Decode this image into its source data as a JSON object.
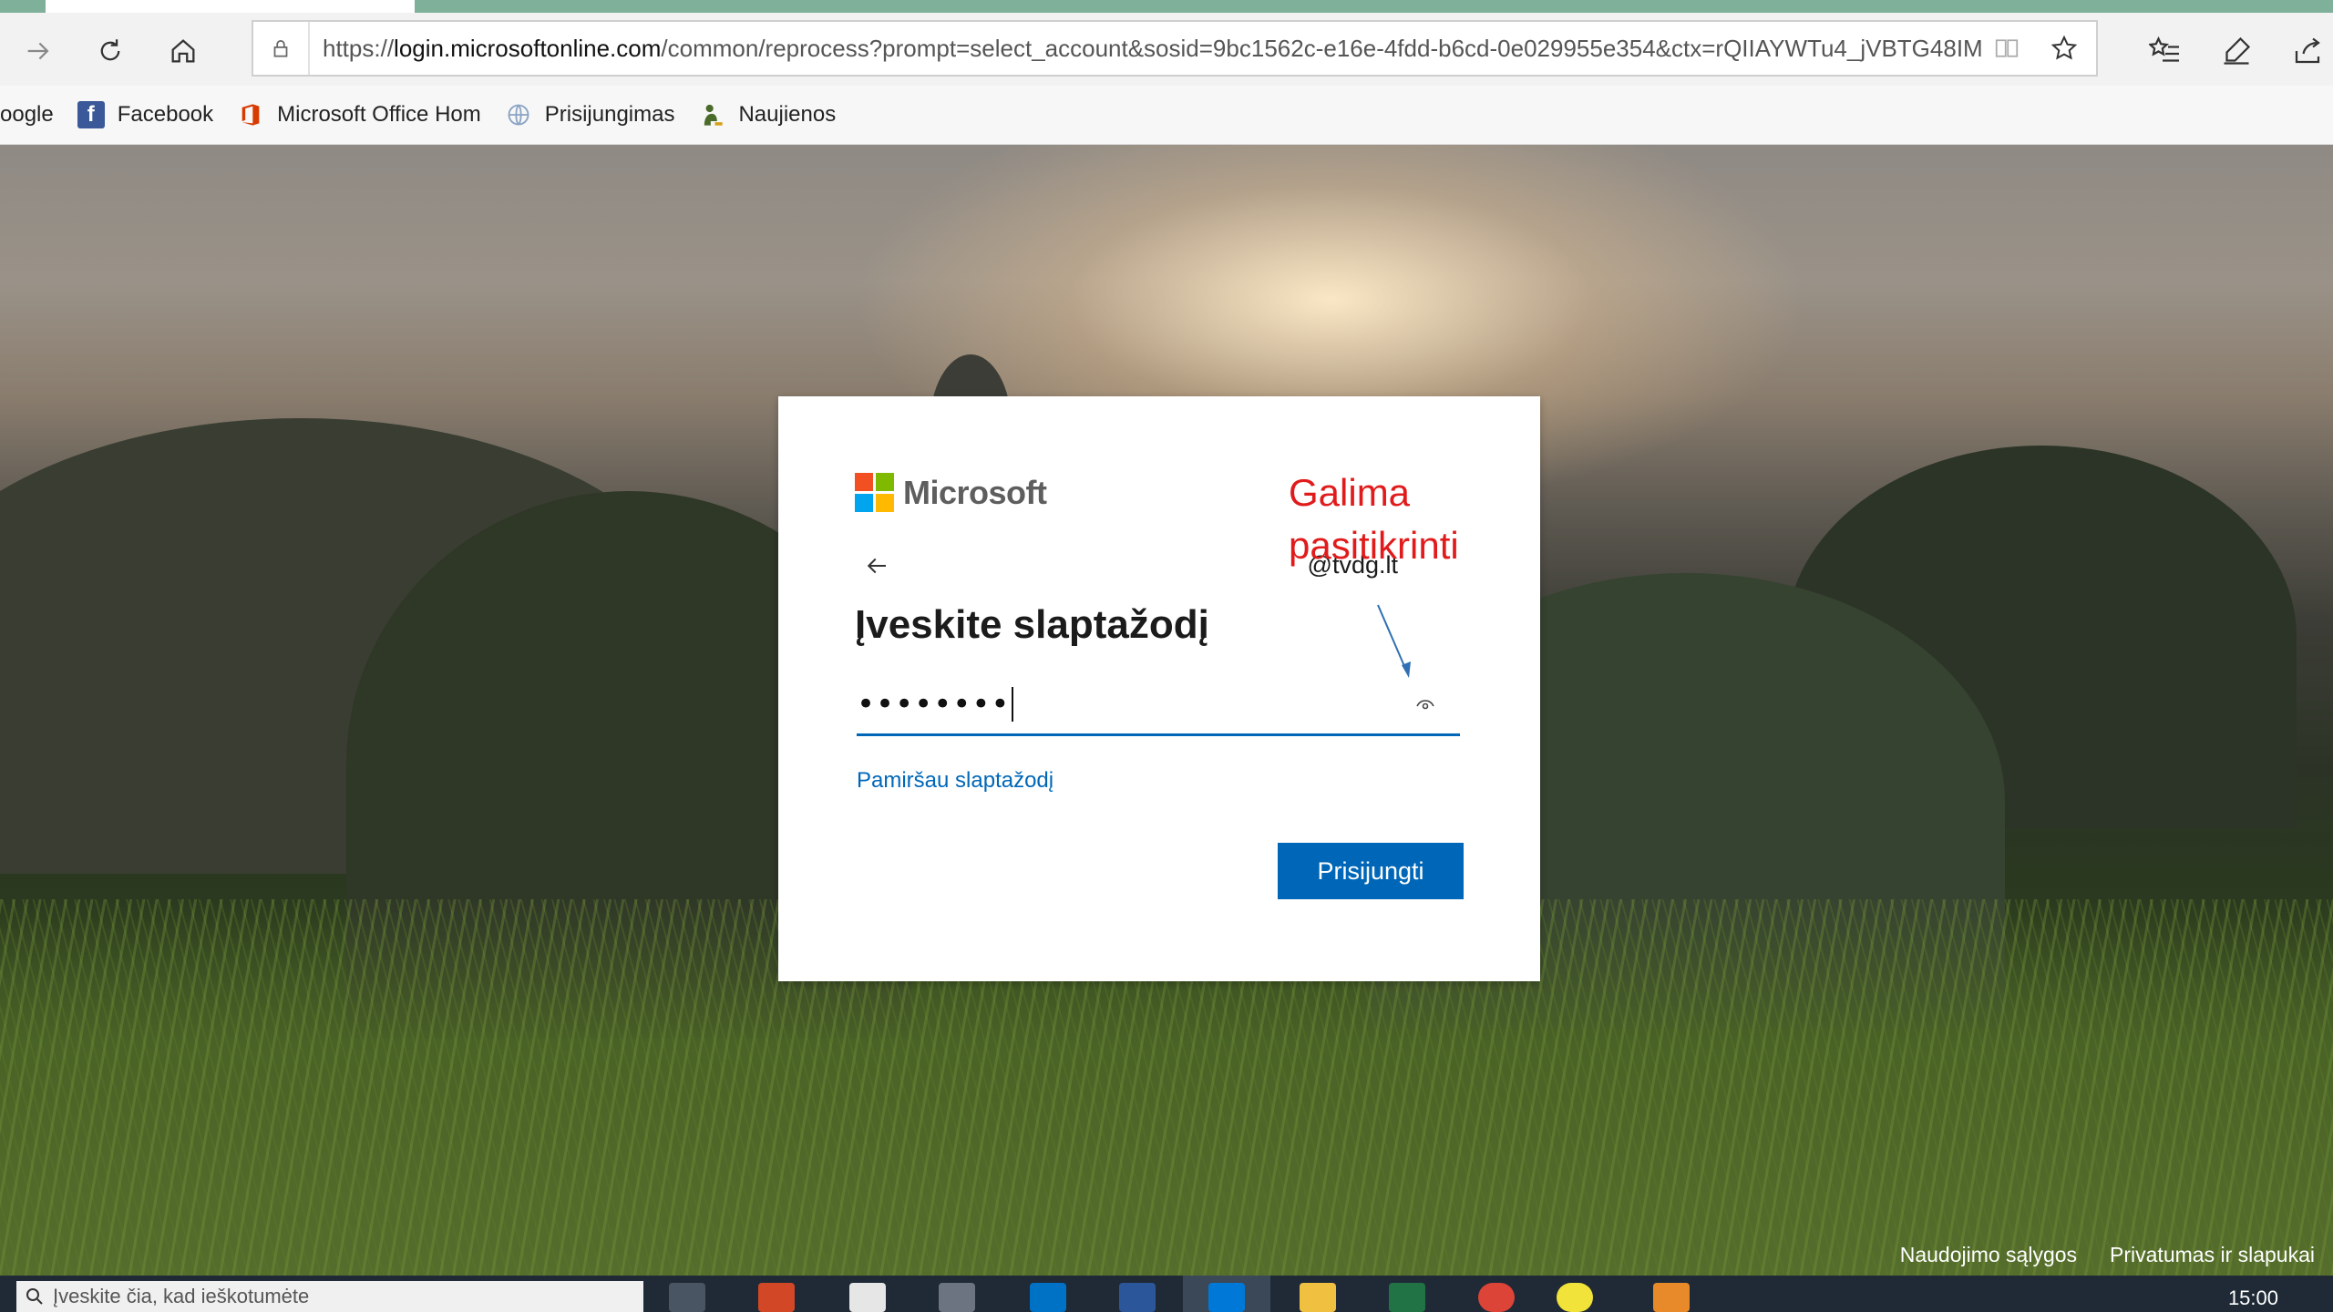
{
  "browser": {
    "url_prefix": "https://",
    "url_host": "login.microsoftonline.com",
    "url_path": "/common/reprocess?prompt=select_account&sosid=9bc1562c-e16e-4fdd-b6cd-0e029955e354&ctx=rQIIAYWTu4_jVBTG48IM"
  },
  "favorites": [
    {
      "label": "oogle"
    },
    {
      "label": "Facebook"
    },
    {
      "label": "Microsoft Office Hom"
    },
    {
      "label": "Prisijungimas"
    },
    {
      "label": "Naujienos"
    }
  ],
  "login": {
    "brand": "Microsoft",
    "account": "@tvdg.lt",
    "heading": "Įveskite slaptažodį",
    "password_mask": "••••••••",
    "forgot_link": "Pamiršau slaptažodį",
    "signin_button": "Prisijungti",
    "logo_colors": [
      "#f25022",
      "#7fba00",
      "#00a4ef",
      "#ffb900"
    ]
  },
  "annotation": {
    "text": "Galima pasitikrinti",
    "color": "#e11b1b"
  },
  "footer": {
    "terms": "Naudojimo sąlygos",
    "privacy": "Privatumas ir slapukai"
  },
  "taskbar": {
    "search_placeholder": "Įveskite čia, kad ieškotumėte",
    "clock": "15:00"
  }
}
